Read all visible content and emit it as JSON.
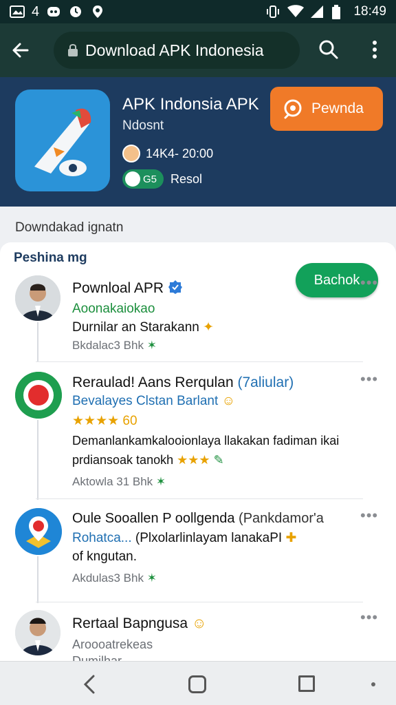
{
  "status_bar": {
    "left_number": "4",
    "time": "18:49"
  },
  "url_bar": {
    "url_text": "Download APK Indonesia"
  },
  "hero": {
    "title": "APK Indonsia APK",
    "subtitle": "Ndosnt",
    "meta_time": "14K4- 20:00",
    "pill_text": "G5",
    "meta_label": "Resol",
    "action_button": "Pewnda"
  },
  "section": {
    "header": "Downdakad ignatn",
    "panel_title": "Peshina mg",
    "action_button": "Bachok"
  },
  "items": [
    {
      "name": "Pownloal APR",
      "line1": "Aoonakaiokao",
      "line2": "Durnilar an Starakann",
      "meta": "Bkdalac3 Bhk"
    },
    {
      "name": "Reraulad! Aans Rerqulan",
      "name_suffix": "(7aliular)",
      "line1": "Bevalayes Clstan Barlant",
      "rating": "★★★★",
      "rating_num": "60",
      "line2": "Demanlankamkalooionlaya llakakan fadiman ikai",
      "line3": "prdiansoak tanokh",
      "line3_stars": "★★★",
      "meta": "Aktowla 31 Bhk"
    },
    {
      "name": "Oule Sooallen P oollgenda",
      "name_suffix": "(Pankdamor'a",
      "line1": "Rohatca...",
      "line1_rest": "(Plxolarlinlayam lanakaPI",
      "line2": "of kngutan.",
      "meta": "Akdulas3 Bhk"
    },
    {
      "name": "Rertaal Bapngusa",
      "line1": "Aroooatrekeas",
      "line2": "Dumilhar"
    }
  ],
  "colors": {
    "accent_orange": "#f07a28",
    "accent_green": "#12a15a",
    "header_navy": "#1d3b5f",
    "urlbar": "#1c3a36"
  }
}
